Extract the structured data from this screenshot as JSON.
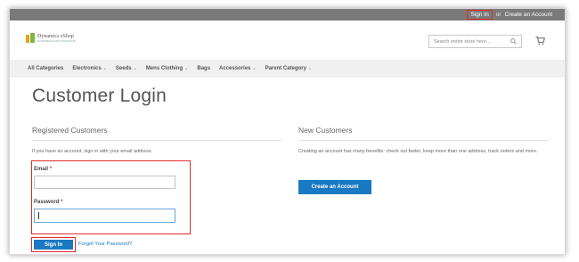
{
  "topbar": {
    "signin": "Sign In",
    "or": "or",
    "create_account": "Create an Account"
  },
  "header": {
    "logo_text": "Dynamics eShop",
    "logo_sub": "ECOMMERCE ERP INTEGRATED",
    "search_placeholder": "Search entire store here..."
  },
  "nav": {
    "items": [
      {
        "label": "All Categories",
        "chevron": false
      },
      {
        "label": "Electronics",
        "chevron": true
      },
      {
        "label": "Seeds",
        "chevron": true
      },
      {
        "label": "Mens Clothing",
        "chevron": true
      },
      {
        "label": "Bags",
        "chevron": false
      },
      {
        "label": "Accessories",
        "chevron": true
      },
      {
        "label": "Parent Category",
        "chevron": true
      }
    ]
  },
  "main": {
    "title": "Customer Login",
    "registered": {
      "title": "Registered Customers",
      "note": "If you have an account, sign in with your email address.",
      "email_label": "Email",
      "password_label": "Password",
      "required_mark": "*",
      "email_value": "",
      "password_value": "",
      "signin_label": "Sign In",
      "forgot_label": "Forgot Your Password?"
    },
    "new_customers": {
      "title": "New Customers",
      "note": "Creating an account has many benefits: check out faster, keep more than one address, track orders and more.",
      "create_label": "Create an Account"
    }
  },
  "colors": {
    "accent": "#1979c3",
    "highlight": "#e02b2b",
    "topbar": "#7a7a7a"
  }
}
